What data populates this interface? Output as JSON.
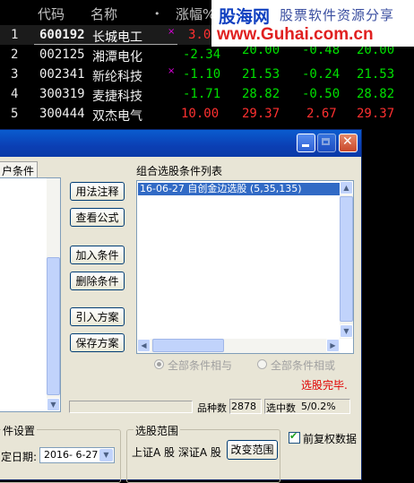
{
  "table": {
    "headers": {
      "code": "代码",
      "name": "名称",
      "dot": "•",
      "change_pct": "涨幅%"
    },
    "rows": [
      {
        "index": "1",
        "code": "600192",
        "name": "长城电工",
        "mark": "×",
        "change_pct": "3.08",
        "price": "",
        "change": "",
        "last": ""
      },
      {
        "index": "2",
        "code": "002125",
        "name": "湘潭电化",
        "mark": "",
        "change_pct": "-2.34",
        "price": "20.00",
        "change": "-0.48",
        "last": "20.00"
      },
      {
        "index": "3",
        "code": "002341",
        "name": "新纶科技",
        "mark": "×",
        "change_pct": "-1.10",
        "price": "21.53",
        "change": "-0.24",
        "last": "21.53"
      },
      {
        "index": "4",
        "code": "300319",
        "name": "麦捷科技",
        "mark": "",
        "change_pct": "-1.71",
        "price": "28.82",
        "change": "-0.50",
        "last": "28.82"
      },
      {
        "index": "5",
        "code": "300444",
        "name": "双杰电气",
        "mark": "",
        "change_pct": "10.00",
        "price": "29.37",
        "change": "2.67",
        "last": "29.37"
      }
    ]
  },
  "watermark": {
    "logo": "股海网",
    "tagline": "股票软件资源分享",
    "url": "www.Guhai.com.cn"
  },
  "dialog": {
    "left_tab": "户条件",
    "buttons": {
      "usage": "用法注释",
      "view_formula": "查看公式",
      "add_condition": "加入条件",
      "delete_condition": "删除条件",
      "import_plan": "引入方案",
      "save_plan": "保存方案",
      "change_range": "改变范围"
    },
    "list_title": "组合选股条件列表",
    "list_items": [
      "16-06-27 自创金边选股 (5,35,135)"
    ],
    "radio_all_and": "全部条件相与",
    "radio_all_or": "全部条件相或",
    "status": "选股完毕.",
    "count_label": "品种数",
    "count_value": "2878",
    "selected_label": "选中数",
    "selected_value": "5/0.2%",
    "settings_title": "件设置",
    "date_label": "定日期:",
    "date_value": "2016- 6-27",
    "range_title": "选股范围",
    "range_text": "上证A 股 深证A 股",
    "restore_label": "前复权数据"
  },
  "colors": {
    "up": "#ff3030",
    "down": "#00e000",
    "titlebar": "#0b3fb4",
    "selection": "#316ac5"
  }
}
